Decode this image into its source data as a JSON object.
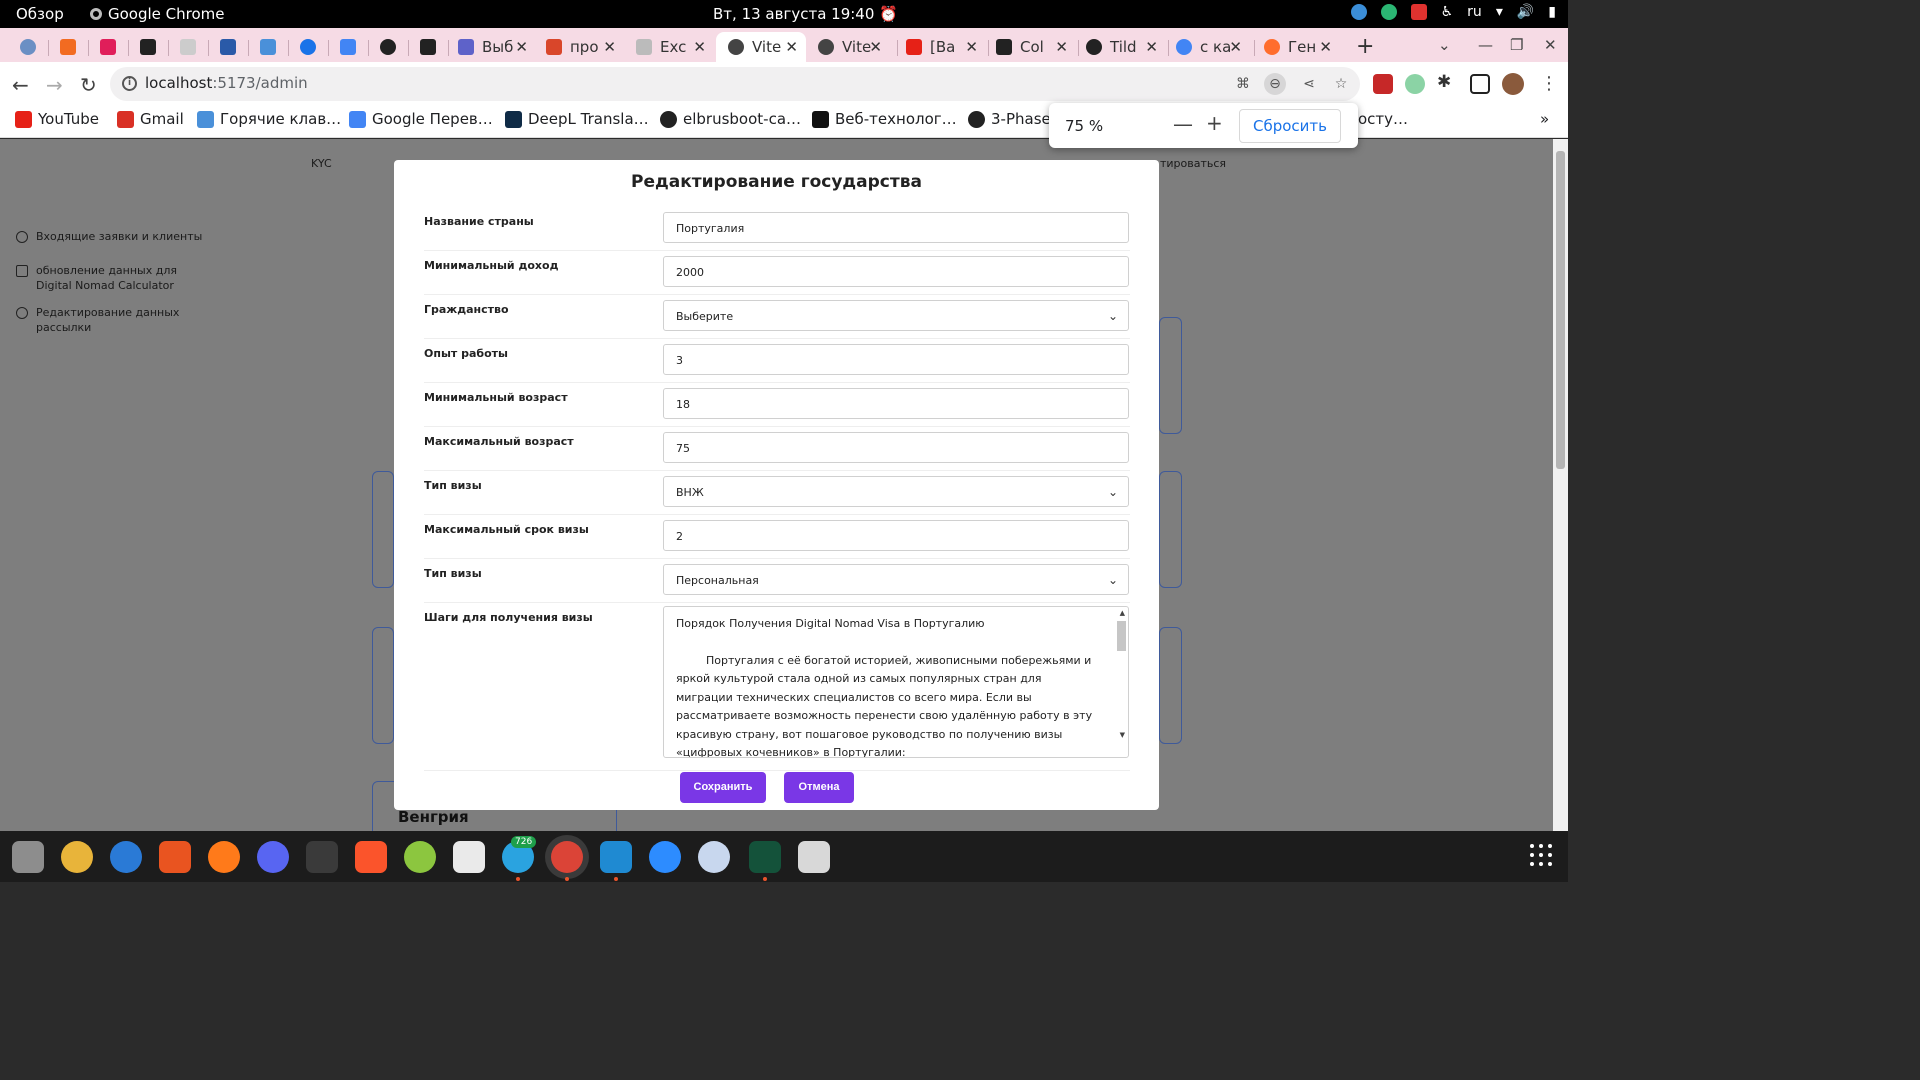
{
  "topbar": {
    "activities": "Обзор",
    "app_name": "Google Chrome",
    "clock": "Вт, 13 августа  19:40",
    "lang": "ru"
  },
  "tabs": [
    {
      "label": "Выб",
      "color": "#5e62c9"
    },
    {
      "label": "про",
      "color": "#d9462a"
    },
    {
      "label": "Exc",
      "color": "#bbbbbb"
    },
    {
      "label": "Vite",
      "color": "#444444"
    },
    {
      "label": "Vite",
      "color": "#444444"
    },
    {
      "label": "[Ва",
      "color": "#e62117"
    },
    {
      "label": "Col",
      "color": "#222222"
    },
    {
      "label": "Tild",
      "color": "#222222"
    },
    {
      "label": "с ка",
      "color": "#4285f4"
    },
    {
      "label": "Ген",
      "color": "#ff6d2d"
    }
  ],
  "toolbar": {
    "url_host": "localhost",
    "url_path": ":5173/admin"
  },
  "bookmarks": [
    {
      "label": "YouTube",
      "color": "#e62117"
    },
    {
      "label": "Gmail",
      "color": "#d93025"
    },
    {
      "label": "Горячие клав…",
      "color": "#4a90d9"
    },
    {
      "label": "Google Перев…",
      "color": "#4285f4"
    },
    {
      "label": "DeepL Transla…",
      "color": "#0f2b46"
    },
    {
      "label": "elbrusboot-ca…",
      "color": "#222222"
    },
    {
      "label": "Веб-технолог…",
      "color": "#111111"
    },
    {
      "label": "3-Phase-",
      "color": "#222222"
    },
    {
      "label": "осту…",
      "color": "#888888"
    }
  ],
  "page": {
    "kyc": "KYC",
    "header_right": "тироваться",
    "sidebar": [
      {
        "label": "Входящие заявки и клиенты"
      },
      {
        "label": "обновление данных для Digital Nomad Calculator"
      },
      {
        "label": "Редактирование данных рассылки"
      }
    ],
    "bottom_card_title": "Венгрия"
  },
  "modal": {
    "title": "Редактирование государства",
    "fields": [
      {
        "label": "Название страны",
        "value": "Португалия",
        "type": "input"
      },
      {
        "label": "Минимальный доход",
        "value": "2000",
        "type": "input"
      },
      {
        "label": "Гражданство",
        "value": "Выберите",
        "type": "select"
      },
      {
        "label": "Опыт работы",
        "value": "3",
        "type": "input"
      },
      {
        "label": "Минимальный возраст",
        "value": "18",
        "type": "input"
      },
      {
        "label": "Максимальный возраст",
        "value": "75",
        "type": "input"
      },
      {
        "label": "Тип визы",
        "value": "ВНЖ",
        "type": "select"
      },
      {
        "label": "Максимальный срок визы",
        "value": "2",
        "type": "input"
      },
      {
        "label": "Тип визы",
        "value": "Персональная",
        "type": "select"
      }
    ],
    "steps_label": "Шаги для получения визы",
    "steps_heading": "Порядок Получения Digital Nomad Visa в Португалию",
    "steps_body": "Португалия с её богатой историей, живописными побережьями и яркой культурой стала одной из самых популярных стран для миграции технических специалистов со всего мира. Если вы рассматриваете возможность перенести свою удалённую работу в эту красивую страну, вот пошаговое руководство по получению визы «цифровых кочевников» в Португалии:",
    "save": "Сохранить",
    "cancel": "Отмена"
  },
  "zoom": {
    "percent": "75 %",
    "reset": "Сбросить"
  },
  "dock": {
    "telegram_badge": "726"
  },
  "colors": {
    "accent": "#7a37e6",
    "tabstrip": "#f6dbe5",
    "overlay": "#7e7e7e"
  }
}
